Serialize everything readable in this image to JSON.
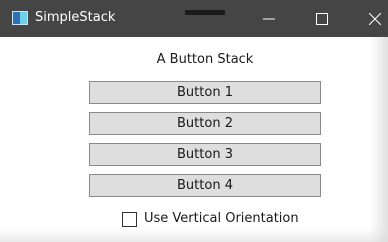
{
  "window": {
    "title": "SimpleStack",
    "icon": "app-window-icon"
  },
  "titlebar": {
    "minimize_icon": "minimize-icon",
    "maximize_icon": "maximize-icon",
    "close_icon": "close-icon"
  },
  "main": {
    "heading": "A Button Stack",
    "buttons": [
      {
        "label": "Button 1"
      },
      {
        "label": "Button 2"
      },
      {
        "label": "Button 3"
      },
      {
        "label": "Button 4"
      }
    ],
    "orientation_checkbox": {
      "label": "Use Vertical Orientation",
      "checked": false
    }
  },
  "colors": {
    "titlebar_bg": "#454545",
    "button_bg": "#dedede",
    "button_border": "#8a8a8a"
  }
}
